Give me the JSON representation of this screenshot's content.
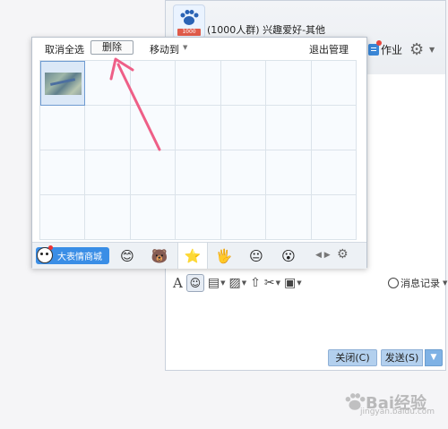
{
  "chat_window": {
    "group_title": "(1000人群) 兴趣爱好-其他",
    "group_avatar_tag": "1000",
    "homework_label": "作业",
    "settings_icon": "gear-icon",
    "history_label": "消息记录",
    "close_label": "关闭(C)",
    "send_label": "发送(S)"
  },
  "emoji_panel": {
    "toolbar": {
      "cancel_select_all": "取消全选",
      "delete": "删除",
      "move_to": "移动到",
      "exit_manage": "退出管理"
    },
    "mall_label": "大表情商城",
    "tabs": [
      {
        "icon": "smiley-icon",
        "glyph": "😊"
      },
      {
        "icon": "bear-icon",
        "glyph": "🐻"
      },
      {
        "icon": "star-icon",
        "glyph": "⭐",
        "active": true
      },
      {
        "icon": "sticker-icon",
        "glyph": "🖐"
      },
      {
        "icon": "face-sticker-icon",
        "glyph": "😐"
      },
      {
        "icon": "penguin-sticker-icon",
        "glyph": "😮"
      }
    ],
    "grid": {
      "columns": 7,
      "rows": 4,
      "selected_cell": 1
    }
  },
  "watermark": {
    "text": "Bai经验",
    "subtext": "jingyan.baidu.com"
  }
}
